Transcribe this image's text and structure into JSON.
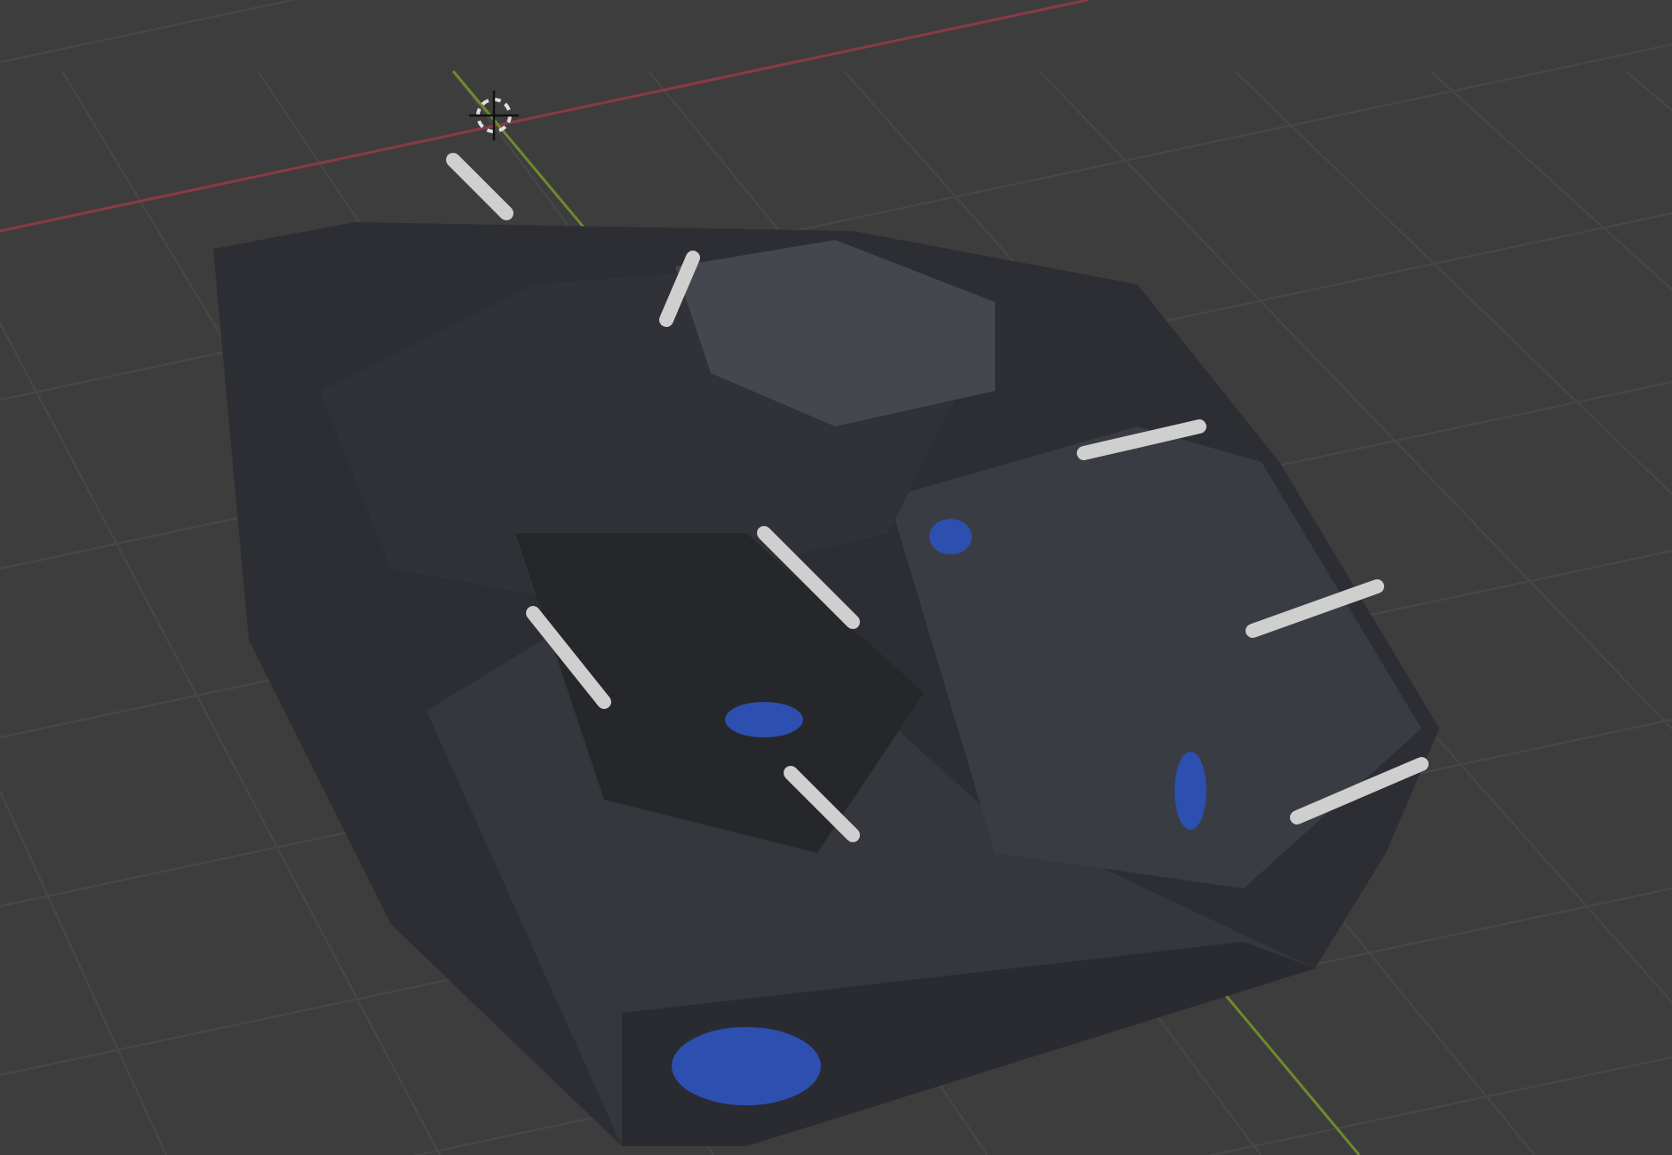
{
  "viewport": {
    "grid": true,
    "x_axis": true,
    "y_axis": true,
    "cursor": true
  }
}
